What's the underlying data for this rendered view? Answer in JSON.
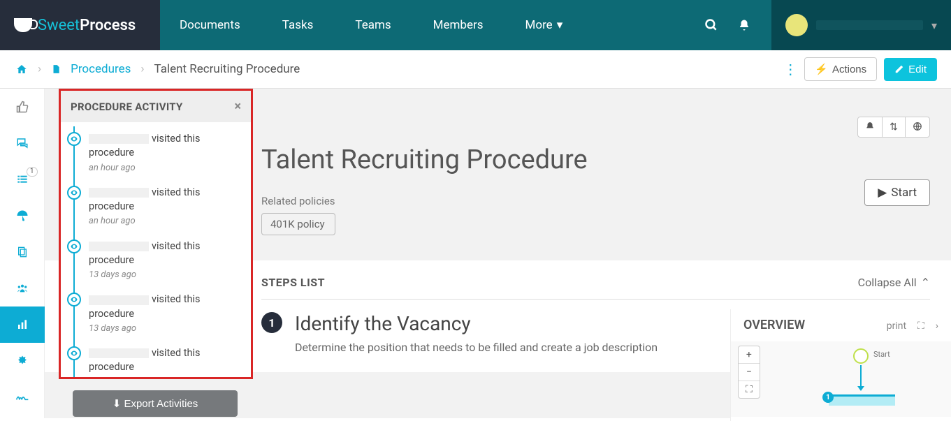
{
  "brand": {
    "sweet": "Sweet",
    "process": "Process"
  },
  "nav": {
    "documents": "Documents",
    "tasks": "Tasks",
    "teams": "Teams",
    "members": "Members",
    "more": "More"
  },
  "breadcrumb": {
    "parent": "Procedures",
    "current": "Talent Recruiting Procedure"
  },
  "buttons": {
    "actions": "Actions",
    "edit": "Edit",
    "start": "Start",
    "export": "Export Activities",
    "collapse": "Collapse All"
  },
  "hero": {
    "title": "Talent Recruiting Procedure",
    "related_label": "Related policies",
    "policy": "401K policy"
  },
  "steps": {
    "section": "STEPS LIST",
    "items": [
      {
        "num": "1",
        "title": "Identify the Vacancy",
        "desc": "Determine the position that needs to be filled and create a job description"
      }
    ]
  },
  "overview": {
    "title": "OVERVIEW",
    "print": "print",
    "start": "Start",
    "step1": "1",
    "zoom_in": "+",
    "zoom_out": "−",
    "zoom_fit": "⛶"
  },
  "drawer": {
    "title": "PROCEDURE ACTIVITY",
    "close": "×",
    "activities": [
      {
        "text": "visited this procedure",
        "time": "an hour ago"
      },
      {
        "text": "visited this procedure",
        "time": "an hour ago"
      },
      {
        "text": "visited this procedure",
        "time": "13 days ago"
      },
      {
        "text": "visited this procedure",
        "time": "13 days ago"
      },
      {
        "text": "visited this procedure",
        "time": ""
      }
    ]
  },
  "rail": {
    "badge": "1"
  }
}
